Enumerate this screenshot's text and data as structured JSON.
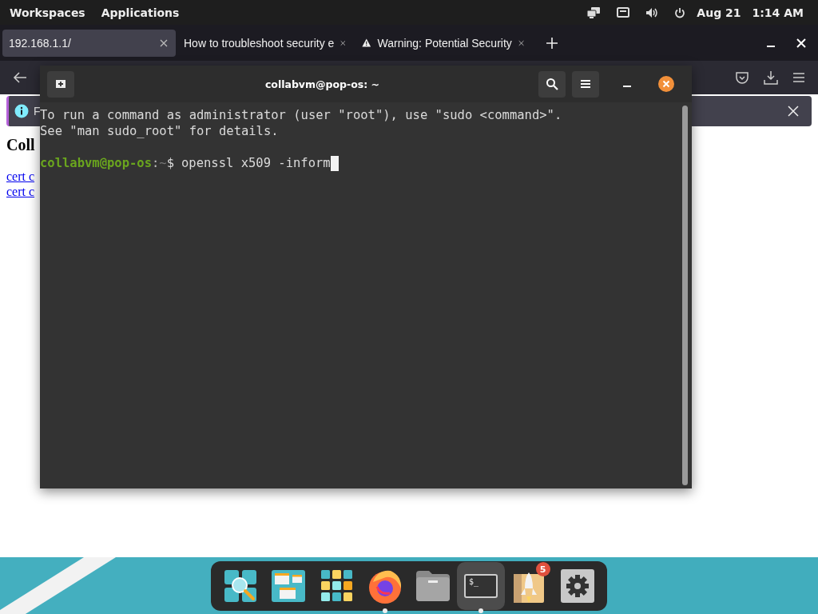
{
  "top_bar": {
    "workspaces": "Workspaces",
    "applications": "Applications",
    "date": "Aug 21",
    "time": "1:14 AM"
  },
  "browser": {
    "tabs": [
      {
        "title": "192.168.1.1/",
        "selected": true,
        "warning": false
      },
      {
        "title": "How to troubleshoot security e",
        "selected": false,
        "warning": false
      },
      {
        "title": "Warning: Potential Security",
        "selected": false,
        "warning": true
      }
    ],
    "info_bar": {
      "text": "F"
    },
    "page": {
      "heading": "Coll",
      "links": [
        "cert c",
        "cert c"
      ]
    }
  },
  "terminal": {
    "title": "collabvm@pop-os: ~",
    "lines": [
      {
        "kind": "output",
        "text": "To run a command as administrator (user \"root\"), use \"sudo <command>\"."
      },
      {
        "kind": "output",
        "text": "See \"man sudo_root\" for details."
      },
      {
        "kind": "prompt",
        "user": "collabvm@pop-os",
        "separator": ":",
        "path": "~",
        "symbol": "$",
        "command": "openssl x509 -inform"
      }
    ]
  },
  "dock": {
    "items": [
      {
        "kind": "search",
        "running": false,
        "selected": false
      },
      {
        "kind": "workspaces",
        "running": false,
        "selected": false
      },
      {
        "kind": "apps",
        "running": false,
        "selected": false
      },
      {
        "kind": "firefox",
        "running": true,
        "selected": false
      },
      {
        "kind": "files",
        "running": false,
        "selected": false
      },
      {
        "kind": "terminal",
        "running": true,
        "selected": true,
        "glyph": "$_"
      },
      {
        "kind": "shop",
        "running": false,
        "selected": false,
        "badge": "5"
      },
      {
        "kind": "settings",
        "running": false,
        "selected": false
      }
    ]
  }
}
